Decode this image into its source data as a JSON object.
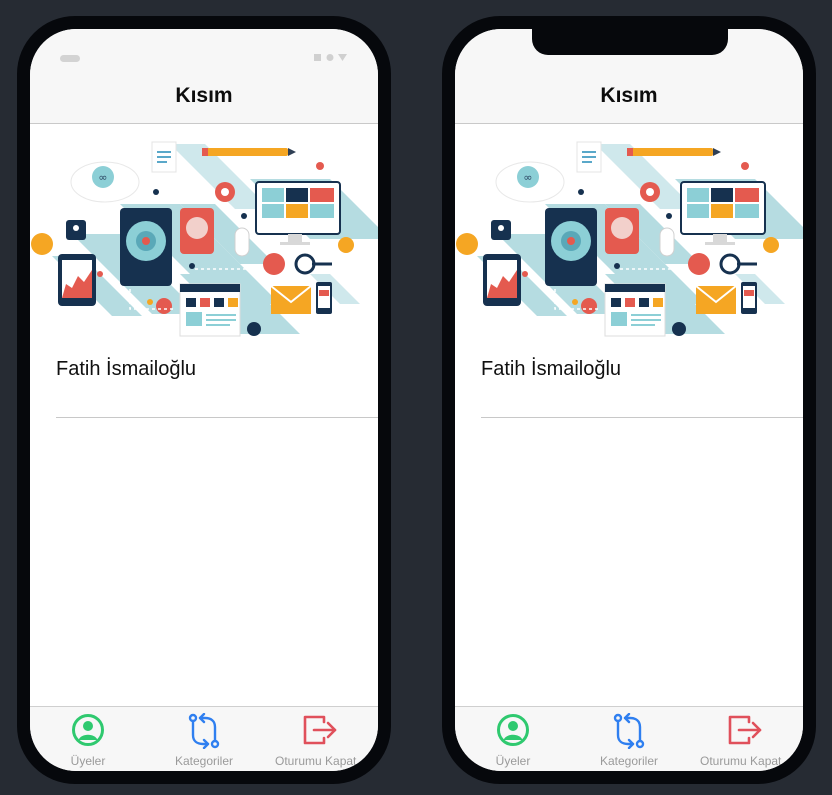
{
  "screen_title": "Kısım",
  "member_name": "Fatih İsmailoğlu",
  "tabs": [
    {
      "label": "Üyeler",
      "icon": "user-circle-icon",
      "color": "#2fc96f"
    },
    {
      "label": "Kategoriler",
      "icon": "swap-arrows-icon",
      "color": "#2f7ff0"
    },
    {
      "label": "Oturumu Kapat",
      "icon": "logout-icon",
      "color": "#e0505b"
    }
  ],
  "colors": {
    "navbar_bg": "#f7f7f7",
    "page_bg": "#262b33",
    "phone_frame": "#06080c"
  }
}
